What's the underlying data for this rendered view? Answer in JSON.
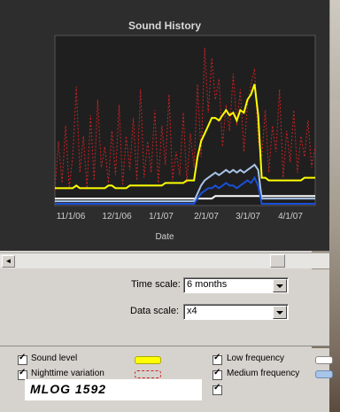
{
  "chart": {
    "title": "Sound History",
    "xlabel": "Date"
  },
  "chart_data": {
    "type": "line",
    "title": "Sound History",
    "xlabel": "Date",
    "ylabel": "",
    "x_tick_labels": [
      "11/1/06",
      "12/1/06",
      "1/1/07",
      "2/1/07",
      "3/1/07",
      "4/1/07"
    ],
    "grid": false,
    "series": [
      {
        "name": "Sound level",
        "color": "#ffff00",
        "values": [
          6,
          6,
          6,
          6,
          6,
          6,
          7,
          6,
          6,
          6,
          6,
          6,
          6,
          6,
          6,
          7,
          7,
          6,
          6,
          6,
          6,
          7,
          7,
          7,
          7,
          7,
          7,
          7,
          7,
          7,
          7,
          8,
          8,
          8,
          8,
          8,
          8,
          9,
          9,
          9,
          18,
          24,
          27,
          30,
          33,
          33,
          32,
          34,
          36,
          34,
          35,
          32,
          36,
          35,
          40,
          42,
          46,
          34,
          10,
          10,
          9,
          9,
          9,
          9,
          9,
          9,
          9,
          9,
          9,
          9,
          10,
          10,
          10,
          10
        ]
      },
      {
        "name": "Nighttime variation",
        "color": "#cc2222",
        "style": "dashed",
        "values": [
          5,
          24,
          8,
          30,
          6,
          18,
          45,
          12,
          26,
          6,
          34,
          9,
          40,
          14,
          22,
          8,
          28,
          11,
          38,
          7,
          26,
          13,
          33,
          9,
          44,
          10,
          24,
          12,
          36,
          8,
          30,
          15,
          42,
          9,
          20,
          11,
          35,
          8,
          27,
          14,
          46,
          18,
          60,
          35,
          56,
          40,
          48,
          22,
          38,
          28,
          50,
          30,
          44,
          20,
          38,
          46,
          52,
          24,
          18,
          36,
          12,
          30,
          20,
          44,
          10,
          28,
          16,
          36,
          12,
          26,
          18,
          32,
          14,
          22
        ]
      },
      {
        "name": "Low frequency",
        "color": "#ffffff",
        "values": [
          2,
          2,
          2,
          2,
          2,
          2,
          2,
          2,
          2,
          2,
          2,
          2,
          2,
          2,
          2,
          2,
          2,
          2,
          2,
          2,
          2,
          2,
          2,
          2,
          2,
          2,
          2,
          2,
          2,
          2,
          2,
          2,
          2,
          2,
          2,
          2,
          2,
          2,
          2,
          2,
          2,
          2,
          2,
          2,
          2,
          3,
          3,
          3,
          3,
          3,
          3,
          3,
          3,
          3,
          3,
          3,
          3,
          3,
          3,
          3,
          3,
          3,
          3,
          3,
          3,
          3,
          3,
          3,
          3,
          3,
          3,
          3,
          3,
          3
        ]
      },
      {
        "name": "Medium frequency",
        "color": "#a8c4e8",
        "values": [
          1,
          1,
          1,
          1,
          1,
          1,
          1,
          1,
          1,
          1,
          1,
          1,
          1,
          1,
          1,
          1,
          1,
          1,
          1,
          1,
          1,
          1,
          1,
          1,
          1,
          1,
          1,
          1,
          1,
          1,
          1,
          1,
          1,
          1,
          1,
          1,
          1,
          1,
          1,
          1,
          4,
          7,
          9,
          10,
          11,
          12,
          11,
          12,
          13,
          12,
          13,
          12,
          13,
          12,
          13,
          14,
          15,
          13,
          2,
          2,
          2,
          2,
          2,
          2,
          2,
          2,
          2,
          2,
          2,
          2,
          2,
          2,
          2,
          2
        ]
      },
      {
        "name": "",
        "color": "#1a4fd8",
        "values": [
          0,
          0,
          0,
          0,
          0,
          0,
          0,
          0,
          0,
          0,
          0,
          0,
          0,
          0,
          0,
          0,
          0,
          0,
          0,
          0,
          0,
          0,
          0,
          0,
          0,
          0,
          0,
          0,
          0,
          0,
          0,
          0,
          0,
          0,
          0,
          0,
          0,
          0,
          0,
          0,
          2,
          4,
          5,
          6,
          6,
          7,
          6,
          7,
          8,
          7,
          7,
          6,
          7,
          8,
          9,
          8,
          10,
          7,
          0,
          0,
          0,
          0,
          0,
          0,
          0,
          0,
          0,
          0,
          0,
          0,
          0,
          0,
          0,
          0
        ]
      }
    ]
  },
  "scrollbar": {
    "left_arrow": "◄"
  },
  "controls": {
    "time_scale_label": "Time scale:",
    "time_scale_value": "6 months",
    "data_scale_label": "Data scale:",
    "data_scale_value": "x4"
  },
  "legend": {
    "items": [
      {
        "label": "Sound level",
        "color": "#ffff00",
        "style": "solid"
      },
      {
        "label": "Nighttime variation",
        "color": "#cc2222",
        "style": "dashed"
      },
      {
        "label": "Low frequency",
        "color": "#ffffff",
        "style": "solid"
      },
      {
        "label": "Medium frequency",
        "color": "#a8c4e8",
        "style": "solid"
      }
    ]
  },
  "watermark": "MLOG 1592"
}
